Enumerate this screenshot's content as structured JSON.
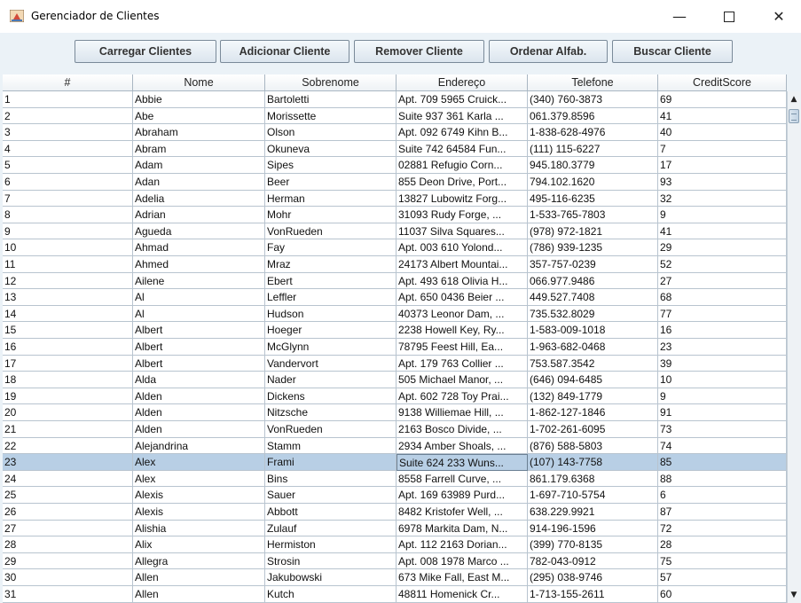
{
  "window": {
    "title": "Gerenciador de Clientes"
  },
  "toolbar": {
    "buttons": [
      "Carregar Clientes",
      "Adicionar Cliente",
      "Remover Cliente",
      "Ordenar Alfab.",
      "Buscar Cliente"
    ]
  },
  "table": {
    "columns": [
      "#",
      "Nome",
      "Sobrenome",
      "Endereço",
      "Telefone",
      "CreditScore"
    ],
    "selected_row": "23",
    "rows": [
      [
        "1",
        "Abbie",
        "Bartoletti",
        "Apt. 709 5965 Cruick...",
        "(340) 760-3873",
        "69"
      ],
      [
        "2",
        "Abe",
        "Morissette",
        "Suite 937 361 Karla ...",
        "061.379.8596",
        "41"
      ],
      [
        "3",
        "Abraham",
        "Olson",
        "Apt. 092 6749 Kihn B...",
        "1-838-628-4976",
        "40"
      ],
      [
        "4",
        "Abram",
        "Okuneva",
        "Suite 742 64584 Fun...",
        "(111) 115-6227",
        "7"
      ],
      [
        "5",
        "Adam",
        "Sipes",
        "02881 Refugio Corn...",
        "945.180.3779",
        "17"
      ],
      [
        "6",
        "Adan",
        "Beer",
        "855 Deon Drive, Port...",
        "794.102.1620",
        "93"
      ],
      [
        "7",
        "Adelia",
        "Herman",
        "13827 Lubowitz Forg...",
        "495-116-6235",
        "32"
      ],
      [
        "8",
        "Adrian",
        "Mohr",
        "31093 Rudy Forge, ...",
        "1-533-765-7803",
        "9"
      ],
      [
        "9",
        "Agueda",
        "VonRueden",
        "11037 Silva Squares...",
        "(978) 972-1821",
        "41"
      ],
      [
        "10",
        "Ahmad",
        "Fay",
        "Apt. 003 610 Yolond...",
        "(786) 939-1235",
        "29"
      ],
      [
        "11",
        "Ahmed",
        "Mraz",
        "24173 Albert Mountai...",
        "357-757-0239",
        "52"
      ],
      [
        "12",
        "Ailene",
        "Ebert",
        "Apt. 493 618 Olivia H...",
        "066.977.9486",
        "27"
      ],
      [
        "13",
        "Al",
        "Leffler",
        "Apt. 650 0436 Beier ...",
        "449.527.7408",
        "68"
      ],
      [
        "14",
        "Al",
        "Hudson",
        "40373 Leonor Dam, ...",
        "735.532.8029",
        "77"
      ],
      [
        "15",
        "Albert",
        "Hoeger",
        "2238 Howell Key, Ry...",
        "1-583-009-1018",
        "16"
      ],
      [
        "16",
        "Albert",
        "McGlynn",
        "78795 Feest Hill, Ea...",
        "1-963-682-0468",
        "23"
      ],
      [
        "17",
        "Albert",
        "Vandervort",
        "Apt. 179 763 Collier ...",
        "753.587.3542",
        "39"
      ],
      [
        "18",
        "Alda",
        "Nader",
        "505 Michael Manor, ...",
        "(646) 094-6485",
        "10"
      ],
      [
        "19",
        "Alden",
        "Dickens",
        "Apt. 602 728 Toy Prai...",
        "(132) 849-1779",
        "9"
      ],
      [
        "20",
        "Alden",
        "Nitzsche",
        "9138 Williemae Hill, ...",
        "1-862-127-1846",
        "91"
      ],
      [
        "21",
        "Alden",
        "VonRueden",
        "2163 Bosco Divide, ...",
        "1-702-261-6095",
        "73"
      ],
      [
        "22",
        "Alejandrina",
        "Stamm",
        "2934 Amber Shoals, ...",
        "(876) 588-5803",
        "74"
      ],
      [
        "23",
        "Alex",
        "Frami",
        "Suite 624 233 Wuns...",
        "(107) 143-7758",
        "85"
      ],
      [
        "24",
        "Alex",
        "Bins",
        "8558 Farrell Curve, ...",
        "861.179.6368",
        "88"
      ],
      [
        "25",
        "Alexis",
        "Sauer",
        "Apt. 169 63989 Purd...",
        "1-697-710-5754",
        "6"
      ],
      [
        "26",
        "Alexis",
        "Abbott",
        "8482 Kristofer Well, ...",
        "638.229.9921",
        "87"
      ],
      [
        "27",
        "Alishia",
        "Zulauf",
        "6978 Markita Dam, N...",
        "914-196-1596",
        "72"
      ],
      [
        "28",
        "Alix",
        "Hermiston",
        "Apt. 112 2163 Dorian...",
        "(399) 770-8135",
        "28"
      ],
      [
        "29",
        "Allegra",
        "Strosin",
        "Apt. 008 1978 Marco ...",
        "782-043-0912",
        "75"
      ],
      [
        "30",
        "Allen",
        "Jakubowski",
        "673 Mike Fall, East M...",
        "(295) 038-9746",
        "57"
      ],
      [
        "31",
        "Allen",
        "Kutch",
        "48811 Homenick Cr...",
        "1-713-155-2611",
        "60"
      ]
    ]
  }
}
